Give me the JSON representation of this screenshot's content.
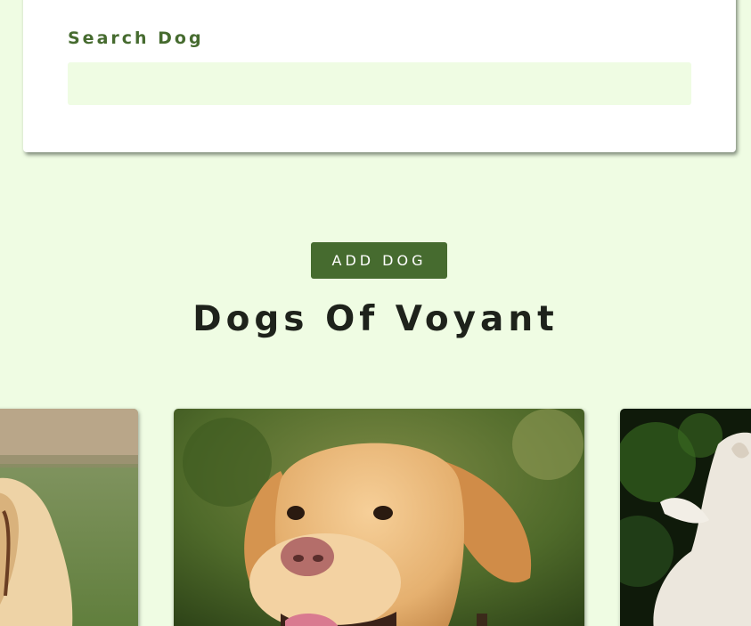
{
  "search": {
    "label": "Search Dog",
    "value": "",
    "placeholder": ""
  },
  "add_button": {
    "label": "ADD DOG"
  },
  "title": "Dogs Of Voyant",
  "dog_cards": [
    {
      "icon": "dog-photo-labrador-on-grass"
    },
    {
      "icon": "dog-photo-golden-labrador-portrait"
    },
    {
      "icon": "dog-photo-white-terrier"
    }
  ],
  "colors": {
    "page_background": "#effce3",
    "accent_green": "#466b2f",
    "title_text": "#1e221b",
    "input_background": "#effce3"
  }
}
